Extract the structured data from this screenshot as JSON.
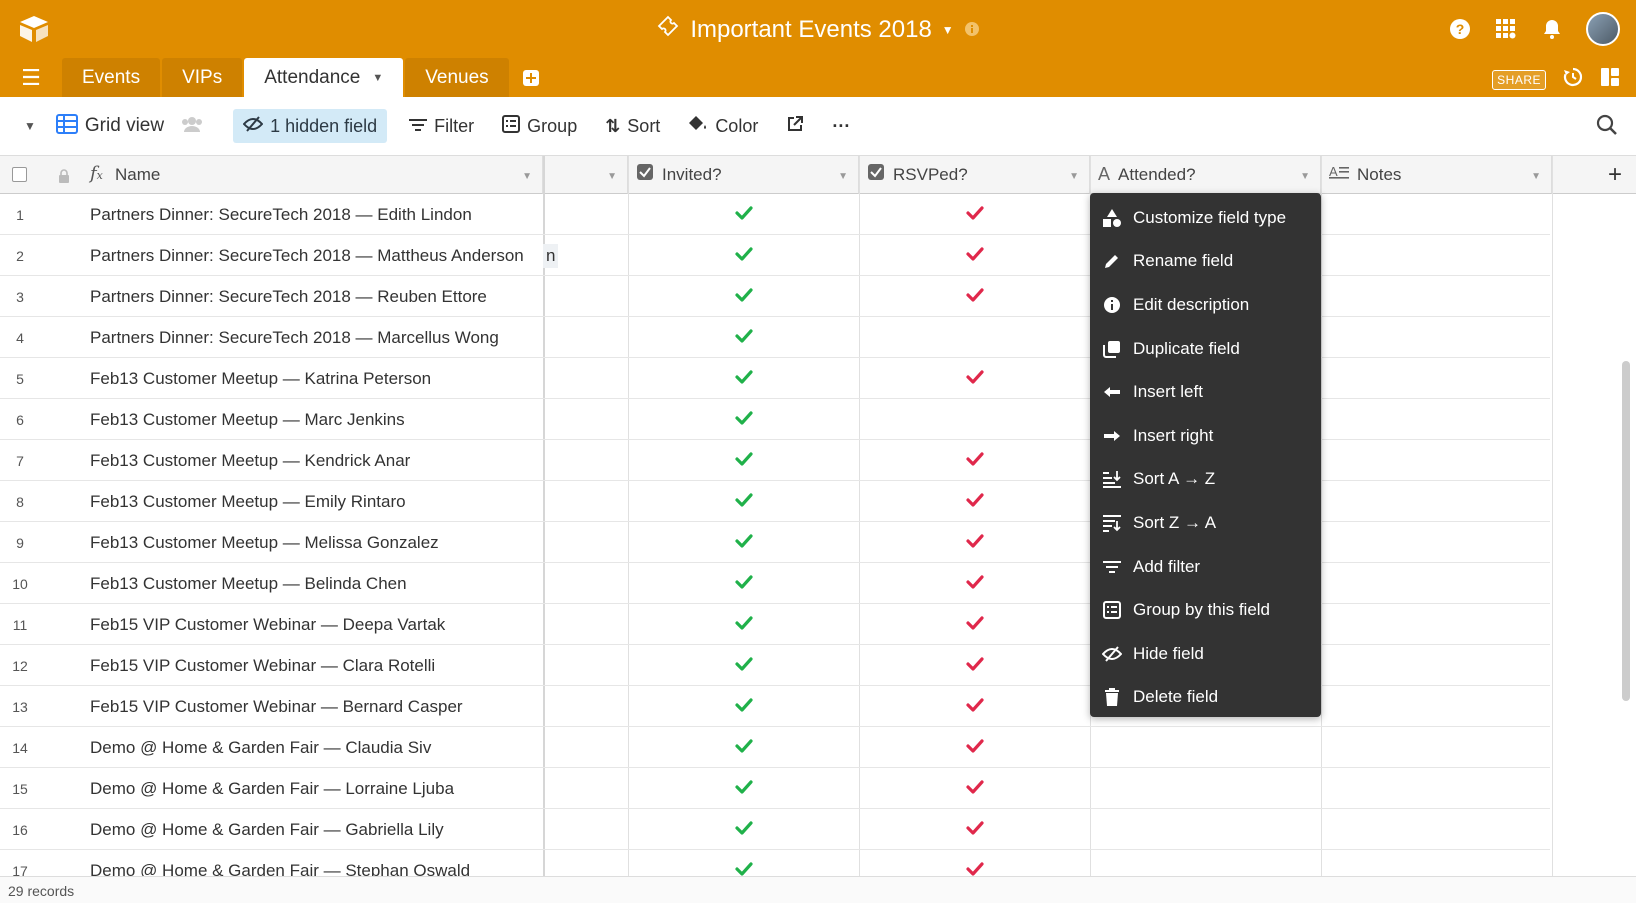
{
  "app": {
    "base_title": "Important Events 2018",
    "share_label": "SHARE",
    "colors": {
      "topbar": "#e08d00",
      "check_green": "#20b14a",
      "check_red": "#e0284b",
      "hidden_field_bg": "#d3eaf7",
      "menu_bg": "#333333"
    }
  },
  "tabs": [
    {
      "label": "Events"
    },
    {
      "label": "VIPs"
    },
    {
      "label": "Attendance"
    },
    {
      "label": "Venues"
    }
  ],
  "toolbar": {
    "view_name": "Grid view",
    "hidden_field": "1 hidden field",
    "filter": "Filter",
    "group": "Group",
    "sort": "Sort",
    "color": "Color",
    "more": "···"
  },
  "columns": {
    "name": "Name",
    "invited": "Invited?",
    "rsvped": "RSVPed?",
    "attended": "Attended?",
    "notes": "Notes"
  },
  "rows": [
    {
      "num": "1",
      "name": "Partners Dinner: SecureTech 2018 — Edith Lindon",
      "invited": true,
      "rsvped": true
    },
    {
      "num": "2",
      "name": "Partners Dinner: SecureTech 2018 — Mattheus Anderson",
      "invited": true,
      "rsvped": true
    },
    {
      "num": "3",
      "name": "Partners Dinner: SecureTech 2018 — Reuben Ettore",
      "invited": true,
      "rsvped": true
    },
    {
      "num": "4",
      "name": "Partners Dinner: SecureTech 2018 — Marcellus Wong",
      "invited": true,
      "rsvped": false
    },
    {
      "num": "5",
      "name": "Feb13 Customer Meetup — Katrina Peterson",
      "invited": true,
      "rsvped": true
    },
    {
      "num": "6",
      "name": "Feb13 Customer Meetup — Marc Jenkins",
      "invited": true,
      "rsvped": false
    },
    {
      "num": "7",
      "name": "Feb13 Customer Meetup — Kendrick Anar",
      "invited": true,
      "rsvped": true
    },
    {
      "num": "8",
      "name": "Feb13 Customer Meetup — Emily Rintaro",
      "invited": true,
      "rsvped": true
    },
    {
      "num": "9",
      "name": "Feb13 Customer Meetup — Melissa Gonzalez",
      "invited": true,
      "rsvped": true
    },
    {
      "num": "10",
      "name": "Feb13 Customer Meetup — Belinda Chen",
      "invited": true,
      "rsvped": true
    },
    {
      "num": "11",
      "name": "Feb15 VIP Customer Webinar — Deepa Vartak",
      "invited": true,
      "rsvped": true
    },
    {
      "num": "12",
      "name": "Feb15 VIP Customer Webinar — Clara Rotelli",
      "invited": true,
      "rsvped": true
    },
    {
      "num": "13",
      "name": "Feb15 VIP Customer Webinar — Bernard Casper",
      "invited": true,
      "rsvped": true
    },
    {
      "num": "14",
      "name": "Demo @ Home & Garden Fair — Claudia Siv",
      "invited": true,
      "rsvped": true
    },
    {
      "num": "15",
      "name": "Demo @ Home & Garden Fair — Lorraine Ljuba",
      "invited": true,
      "rsvped": true
    },
    {
      "num": "16",
      "name": "Demo @ Home & Garden Fair — Gabriella Lily",
      "invited": true,
      "rsvped": true
    },
    {
      "num": "17",
      "name": "Demo @ Home & Garden Fair — Stephan Oswald",
      "invited": true,
      "rsvped": true
    }
  ],
  "row2_partial": "n",
  "menu": [
    {
      "label": "Customize field type",
      "icon": "shapes-icon"
    },
    {
      "label": "Rename field",
      "icon": "pencil-icon"
    },
    {
      "label": "Edit description",
      "icon": "info-icon"
    },
    {
      "label": "Duplicate field",
      "icon": "duplicate-icon"
    },
    {
      "label": "Insert left",
      "icon": "arrow-left-icon"
    },
    {
      "label": "Insert right",
      "icon": "arrow-right-icon"
    },
    {
      "label": "Sort A → Z",
      "icon": "sort-asc-icon"
    },
    {
      "label": "Sort Z → A",
      "icon": "sort-desc-icon"
    },
    {
      "label": "Add filter",
      "icon": "filter-icon"
    },
    {
      "label": "Group by this field",
      "icon": "group-icon"
    },
    {
      "label": "Hide field",
      "icon": "hide-icon"
    },
    {
      "label": "Delete field",
      "icon": "trash-icon"
    }
  ],
  "footer": {
    "records": "29 records"
  }
}
